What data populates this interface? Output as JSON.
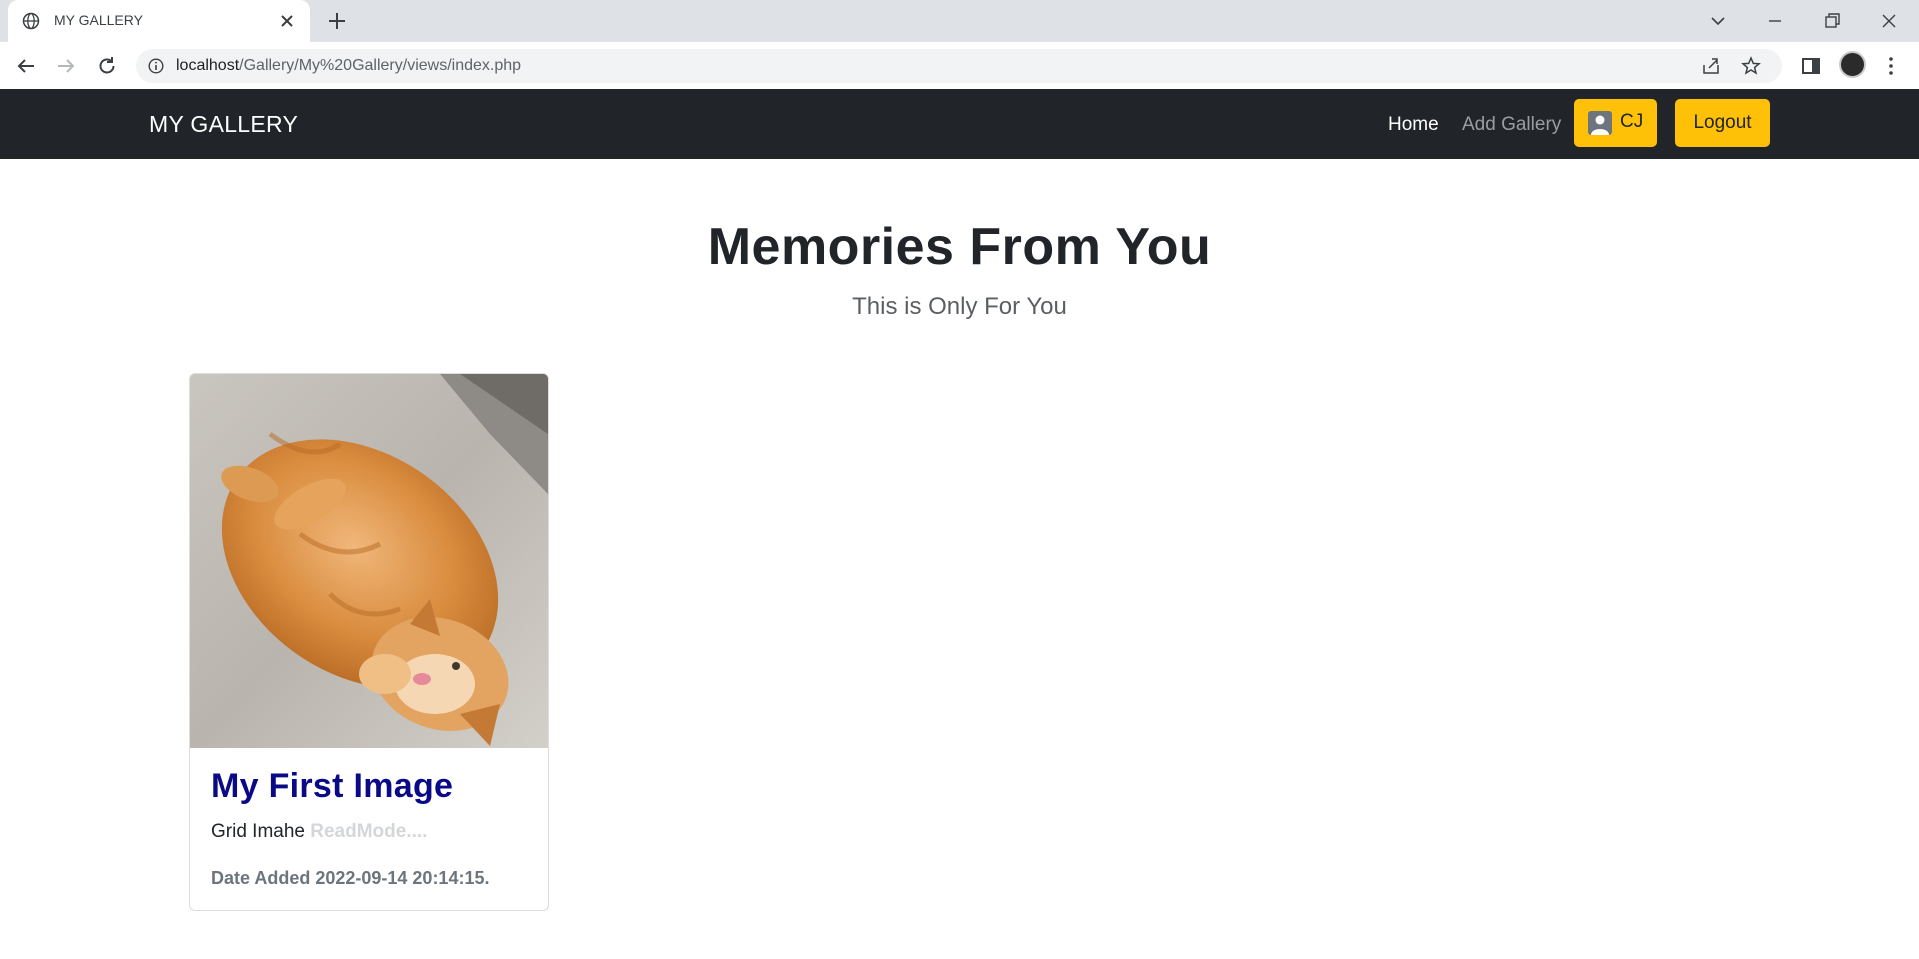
{
  "browser": {
    "tab_title": "MY GALLERY",
    "url_host": "localhost",
    "url_path": "/Gallery/My%20Gallery/views/index.php"
  },
  "navbar": {
    "brand": "MY GALLERY",
    "links": [
      "Home",
      "Add Gallery"
    ],
    "user_label": "CJ",
    "logout_label": "Logout"
  },
  "header": {
    "title": "Memories From You",
    "subtitle": "This is Only For You"
  },
  "cards": [
    {
      "title": "My First Image",
      "description": "Grid Imahe",
      "read_more": "ReadMode....",
      "date_label": "Date Added 2022-09-14 20:14:15."
    }
  ],
  "colors": {
    "navbar_bg": "#212529",
    "accent_yellow": "#ffc107",
    "card_title": "#0a0a86"
  }
}
